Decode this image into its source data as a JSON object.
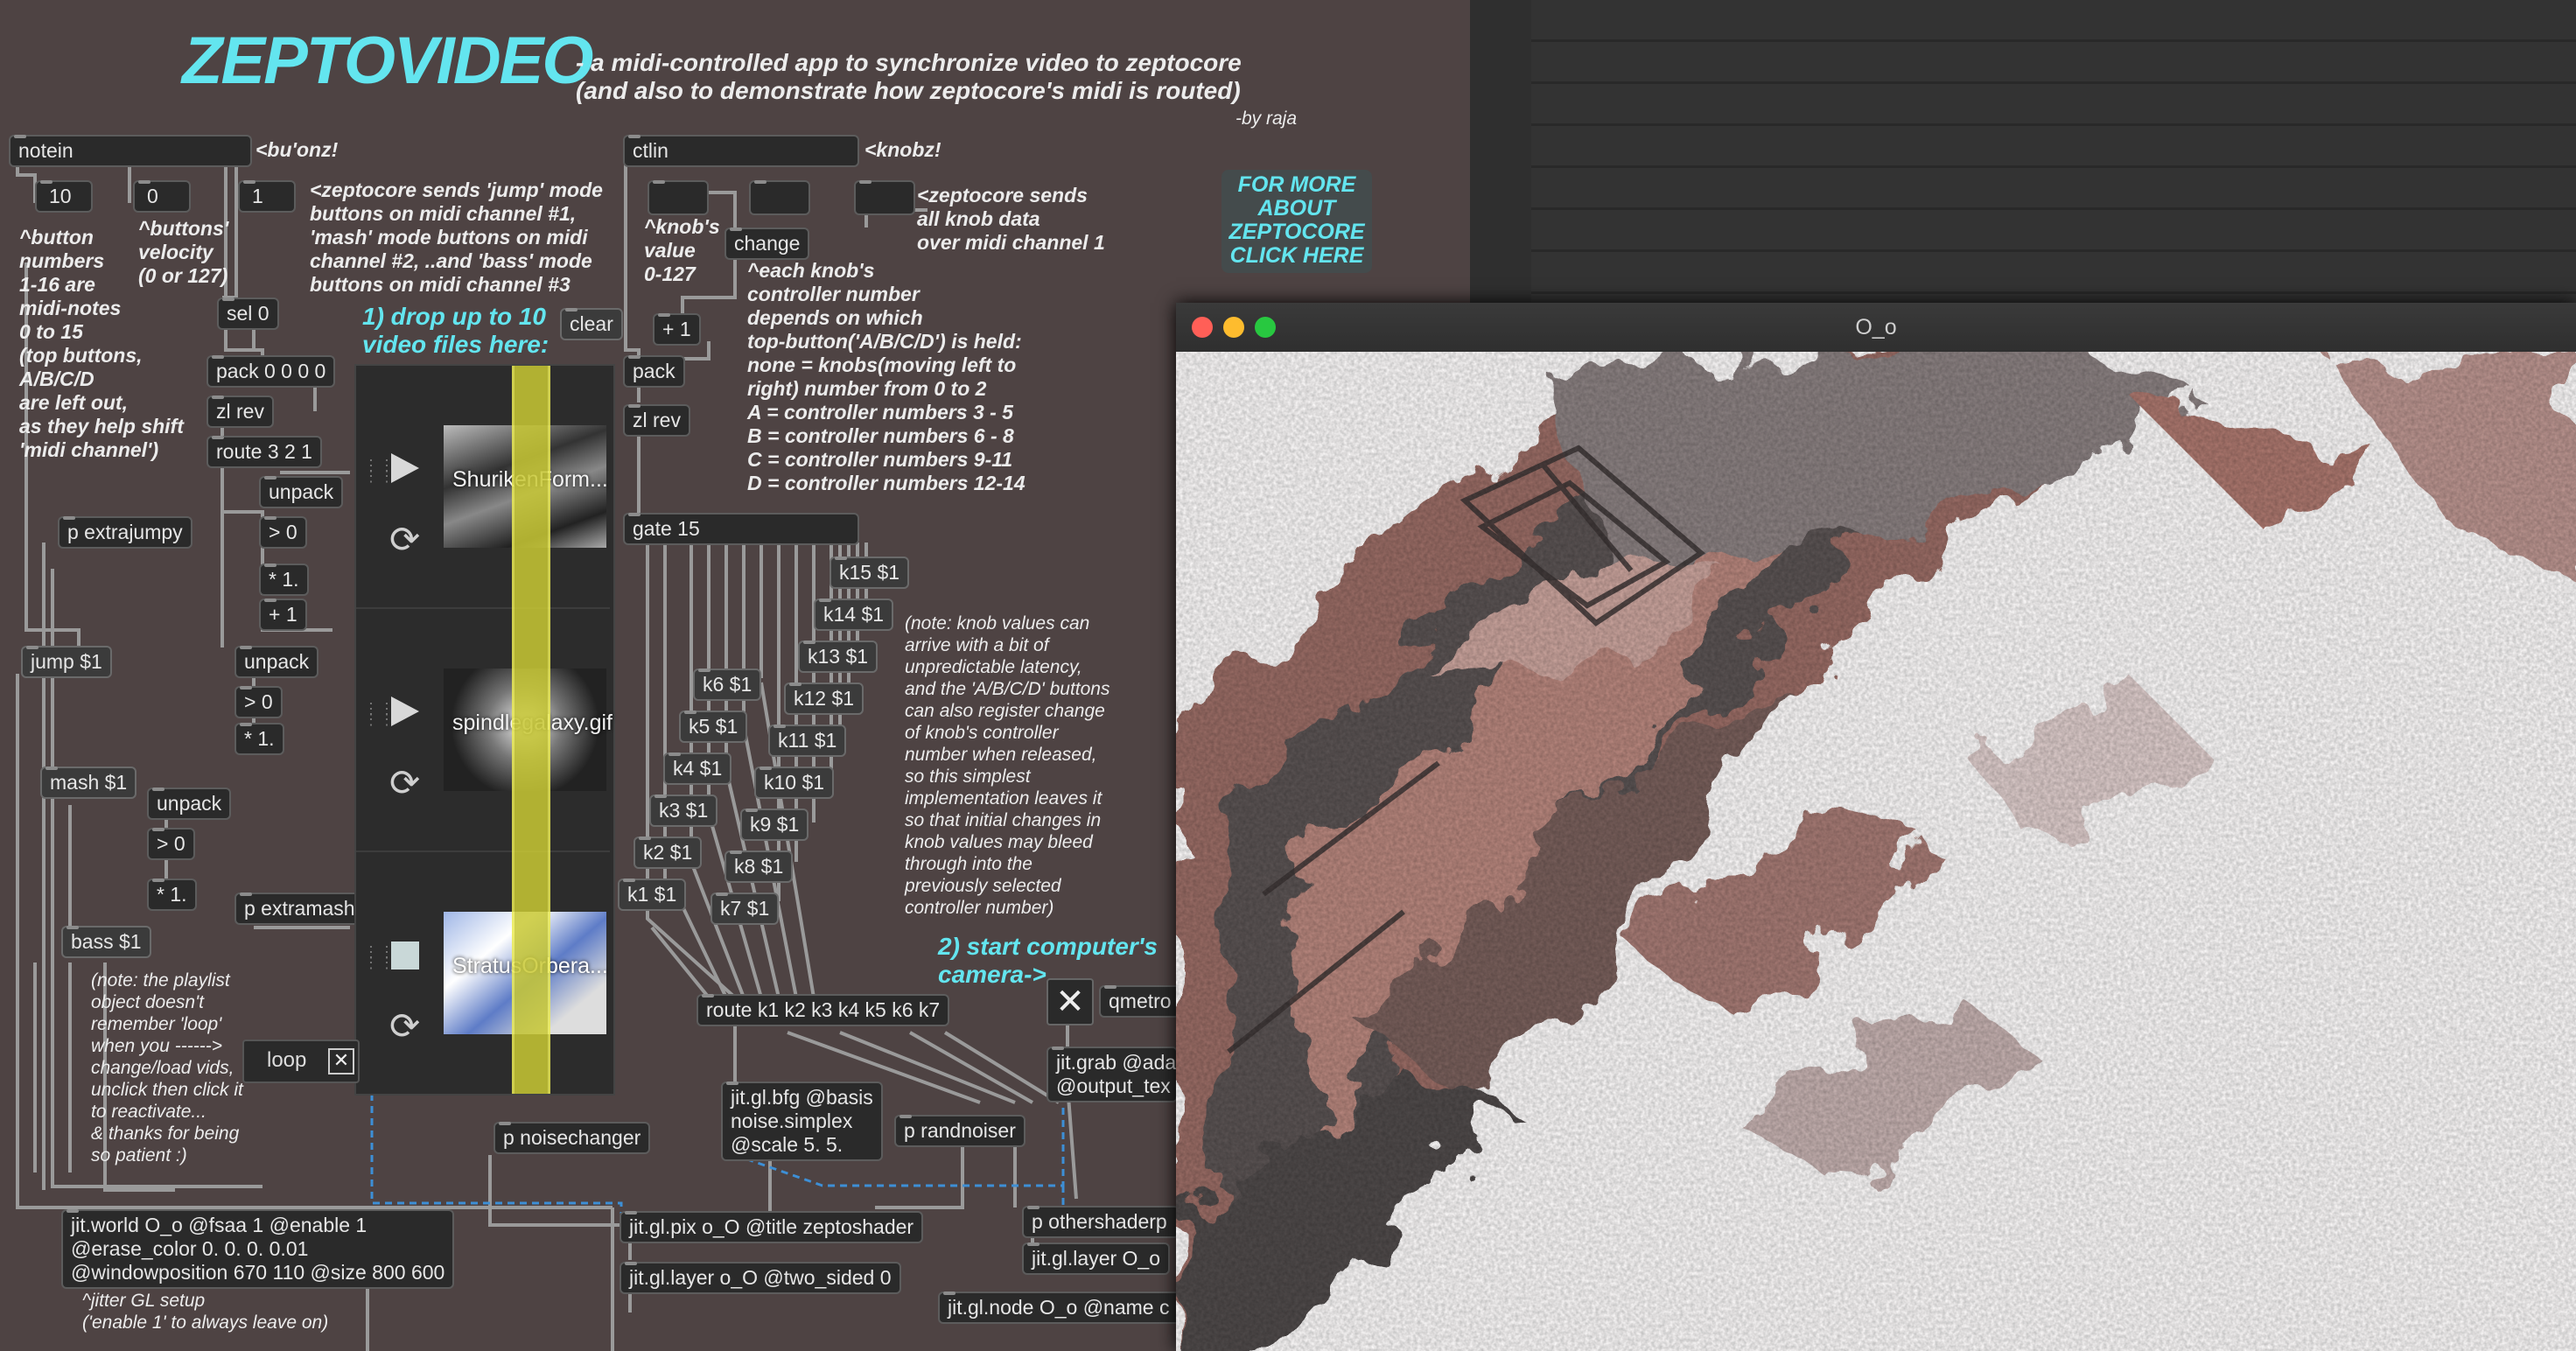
{
  "patcher": {
    "title": "ZEPTOVIDEO",
    "subtitle": "- a midi-controlled app to synchronize video to zeptocore\n(and also to demonstrate how zeptocore's midi is routed)",
    "byline": "-by raja",
    "more_button": "FOR MORE\nABOUT\nZEPTOCORE\nCLICK HERE",
    "objects": {
      "notein": "notein",
      "num_10": "10",
      "num_0": "0",
      "num_1": "1",
      "ctlin": "ctlin",
      "change": "change",
      "plus1_top": "+ 1",
      "pack_ctl": "pack",
      "zlrev_ctl": "zl rev",
      "gate": "gate 15",
      "sel0": "sel 0",
      "pack0000": "pack 0 0 0 0",
      "zlrev": "zl rev",
      "route3210": "route 3 2 1",
      "unpack1": "unpack",
      "gt0_1": "> 0",
      "mul1_1": "* 1.",
      "plus1_2": "+ 1",
      "unpack2": "unpack",
      "gt0_2": "> 0",
      "mul1_2": "* 1.",
      "unpack3": "unpack",
      "gt0_3": "> 0",
      "mul1_3": "* 1.",
      "p_extrajumpy": "p extrajumpy",
      "jump": "jump $1",
      "mash": "mash $1",
      "bass": "bass $1",
      "p_extramashy": "p extramashy",
      "clear": "clear",
      "loop": "loop",
      "k15": "k15 $1",
      "k14": "k14 $1",
      "k13": "k13 $1",
      "k12": "k12 $1",
      "k11": "k11 $1",
      "k10": "k10 $1",
      "k9": "k9 $1",
      "k8": "k8 $1",
      "k7": "k7 $1",
      "k6": "k6 $1",
      "k5": "k5 $1",
      "k4": "k4 $1",
      "k3": "k3 $1",
      "k2": "k2 $1",
      "k1": "k1 $1",
      "route_k": "route k1 k2 k3 k4 k5 k6 k7",
      "bfg": "jit.gl.bfg @basis\nnoise.simplex\n@scale 5. 5.",
      "p_noisechanger": "p noisechanger",
      "p_randnoiser": "p randnoiser",
      "qmetro": "qmetro",
      "grab": "jit.grab @ada\n@output_tex",
      "world": "jit.world O_o @fsaa 1 @enable 1\n@erase_color 0. 0. 0. 0.01\n@windowposition 670 110 @size 800 600",
      "pix": "jit.gl.pix o_O @title zeptoshader",
      "layer": "jit.gl.layer o_O @two_sided 0",
      "othershader": "p othershaderp",
      "layer2": "jit.gl.layer O_o",
      "node": "jit.gl.node O_o @name c"
    },
    "comments": {
      "buonz": "<bu'onz!",
      "knobz": "<knobz!",
      "button_numbers": "^button\nnumbers\n1-16 are\nmidi-notes\n0 to 15\n(top buttons,\nA/B/C/D\nare left out,\nas they help shift\n'midi channel')",
      "velocity": "^buttons'\nvelocity\n(0 or 127)",
      "zeptocore_jump": "<zeptocore sends 'jump' mode\nbuttons on midi channel #1,\n'mash' mode buttons on midi\nchannel #2, ..and 'bass' mode\nbuttons on midi channel #3",
      "knob_value": "^knob's\nvalue\n0-127",
      "all_knob": "<zeptocore sends\nall knob data\nover midi channel 1",
      "each_knob": "^each knob's\ncontroller number\ndepends on which\ntop-button('A/B/C/D') is held:\nnone = knobs(moving left to\nright) number from 0 to 2\nA = controller numbers 3 - 5\nB = controller numbers 6 - 8\nC = controller numbers 9-11\nD = controller numbers 12-14",
      "note_latency": "(note: knob values can\narrive with a bit of\nunpredictable latency,\nand the 'A/B/C/D' buttons\ncan also register change\nof knob's controller\nnumber when released,\nso this simplest\nimplementation leaves it\nso that initial changes in\nknob values may bleed\nthrough into the\npreviously selected\ncontroller number)",
      "drop_videos": "1) drop up to 10\nvideo files here:",
      "start_camera": "2) start computer's\ncamera->",
      "playlist_note": "(note: the playlist\nobject doesn't\nremember 'loop'\nwhen you ------>\nchange/load vids,\nunclick then click it\nto reactivate...\n& thanks for being\nso patient :)",
      "jitter_setup": "^jitter GL setup\n('enable 1' to always leave on)"
    },
    "playlist": [
      {
        "name": "ShurikenForm...",
        "state": "play"
      },
      {
        "name": "spindlegalaxy.gif",
        "state": "play"
      },
      {
        "name": "StratusOrbera...",
        "state": "stop"
      }
    ]
  },
  "video_window": {
    "title": "O_o"
  },
  "colors": {
    "patcher_bg": "#4e4343",
    "accent_cyan": "#63e5ef",
    "playlist_bar": "#c9c934",
    "close": "#ff5f57",
    "minimize": "#febc2e",
    "zoom": "#28c840"
  }
}
